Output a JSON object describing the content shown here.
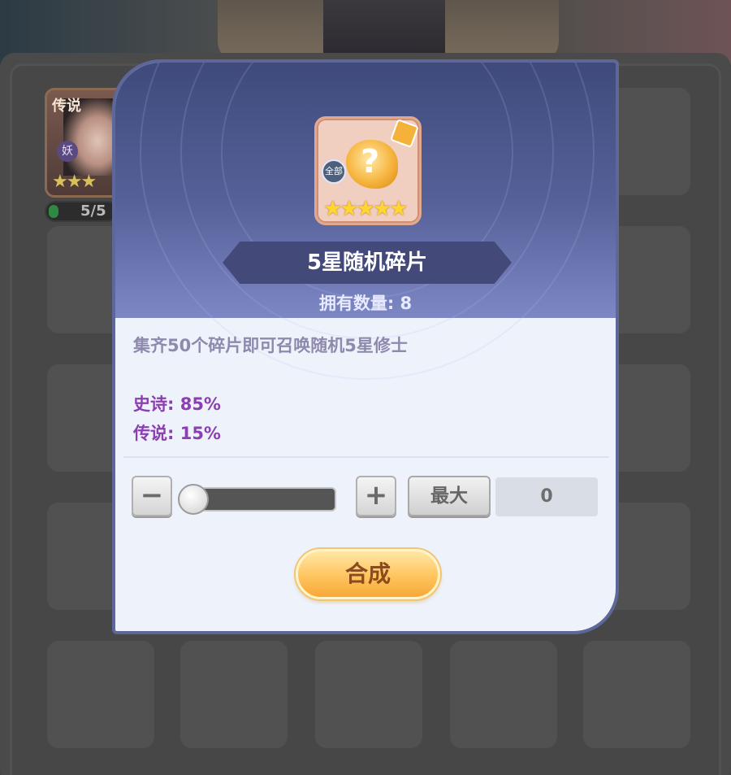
{
  "background": {
    "hero_card": {
      "tag": "传说",
      "race": "妖",
      "stars": "★★★",
      "progress_text": "5/5",
      "progress": 1
    }
  },
  "modal": {
    "item": {
      "name": "5星随机碎片",
      "badge": "全部",
      "icon": "random-fragment-icon",
      "stars": "★★★★★",
      "count_label": "拥有数量: 8"
    },
    "description": "集齐50个碎片即可召唤随机5星修士",
    "rates": [
      {
        "text": "史诗: 85%"
      },
      {
        "text": "传说: 15%"
      }
    ],
    "controls": {
      "minus_icon": "minus-icon",
      "plus_icon": "plus-icon",
      "max_label": "最大",
      "quantity": "0",
      "slider_level": 0
    },
    "compose_label": "合成"
  },
  "colors": {
    "header": "#56619a",
    "body": "#eef3fb",
    "rate_text": "#8b3fb0",
    "compose_button": "#ffc45e"
  }
}
